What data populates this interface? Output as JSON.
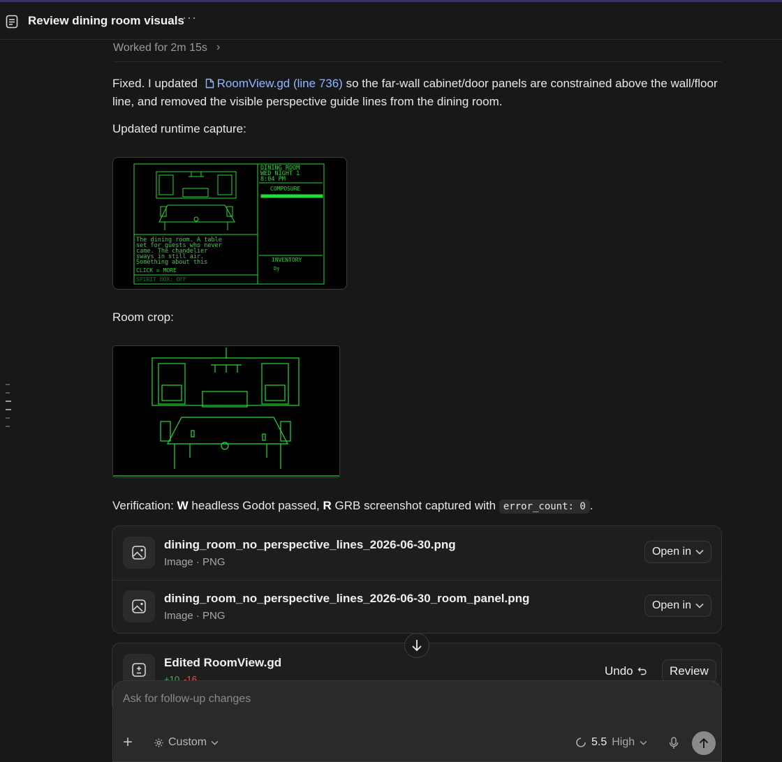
{
  "header": {
    "title": "Review dining room visuals",
    "more_label": "···"
  },
  "worked": {
    "label": "Worked for 2m 15s"
  },
  "message": {
    "p1_before": "Fixed. I updated",
    "file_link": "RoomView.gd (line 736)",
    "p1_after": "so the far-wall cabinet/door panels are constrained above the wall/floor line, and removed the visible perspective guide lines from the dining room.",
    "capture_label": "Updated runtime capture:",
    "room_crop_label": "Room crop:",
    "verification_prefix": "Verification:",
    "w_key": "W",
    "headless_text": "headless Godot passed,",
    "r_key": "R",
    "grb_text": "GRB screenshot captured with",
    "error_code": "error_count: 0",
    "end": "."
  },
  "game_screen": {
    "room_name": "DINING ROOM",
    "day": "WED NIGHT 1",
    "time": "8:04 PM",
    "composure_label": "COMPOSURE",
    "narration": [
      "The dining room. A table",
      "set for guests who never",
      "came. The chandelier",
      "sways in still air.",
      "Something about this"
    ],
    "click_more": "CLICK = MORE",
    "spirit_box": "SPIRIT BOX: OFF",
    "inventory_label": "INVENTORY",
    "inventory_item": "Dy"
  },
  "files": [
    {
      "name": "dining_room_no_perspective_lines_2026-06-30.png",
      "type": "Image · PNG",
      "action": "Open in"
    },
    {
      "name": "dining_room_no_perspective_lines_2026-06-30_room_panel.png",
      "type": "Image · PNG",
      "action": "Open in"
    }
  ],
  "edit": {
    "title": "Edited RoomView.gd",
    "added": "+10",
    "removed": "-16",
    "undo_label": "Undo",
    "review_label": "Review"
  },
  "composer": {
    "placeholder": "Ask for follow-up changes",
    "mode": "Custom",
    "model_version": "5.5",
    "effort": "High"
  },
  "colors": {
    "terminal_green": "#22dd33",
    "link": "#8fb7ff"
  }
}
